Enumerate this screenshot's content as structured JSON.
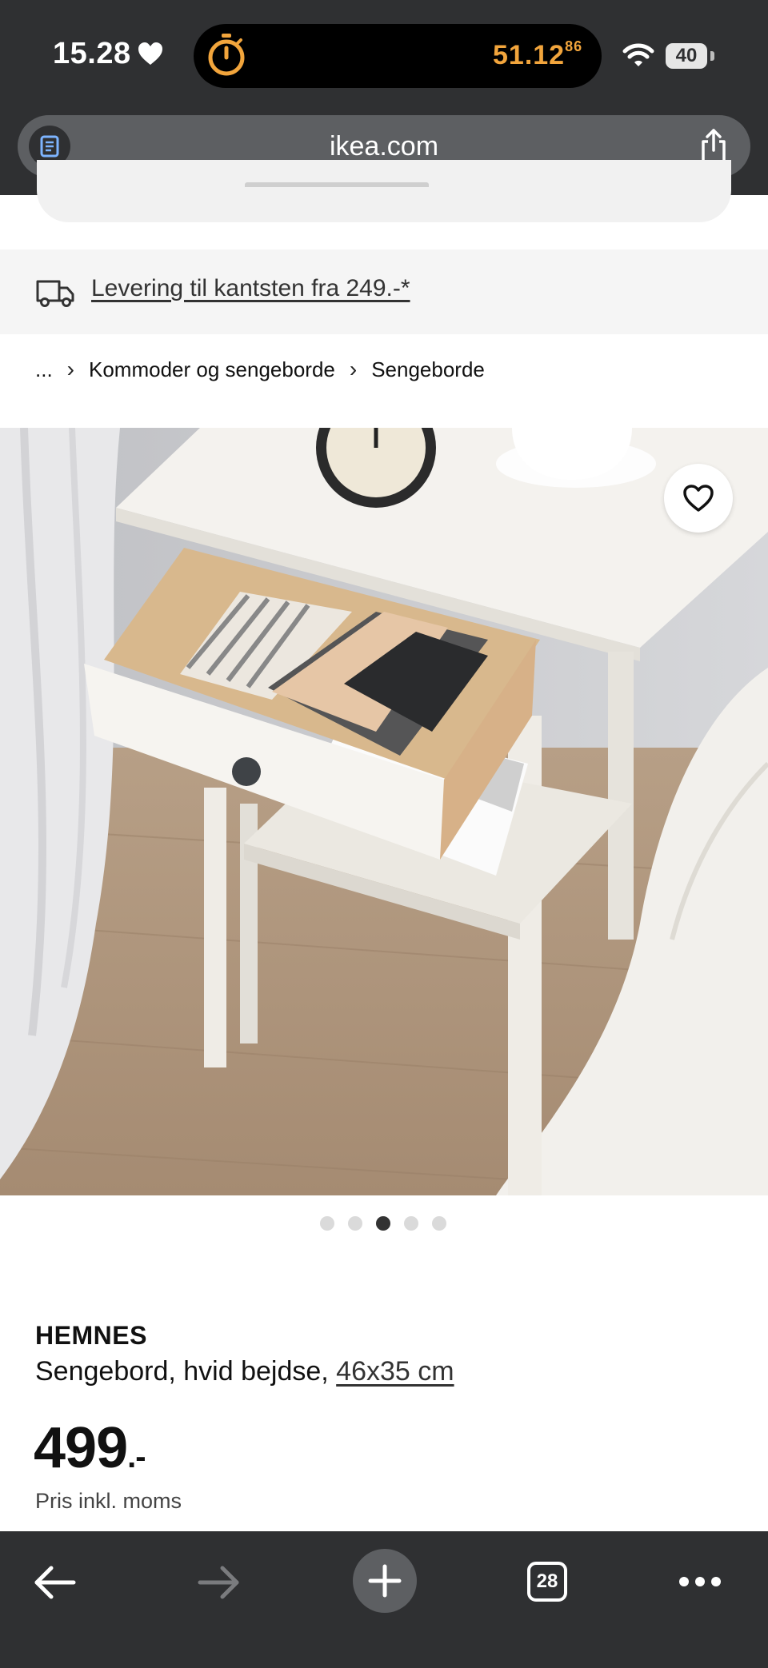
{
  "status_bar": {
    "time": "15.28",
    "timer_main": "51.12",
    "timer_fraction": "86",
    "battery": "40",
    "timer_color": "#f2a53c"
  },
  "browser": {
    "url": "ikea.com"
  },
  "delivery_banner": {
    "text": "Levering til kantsten fra 249.-*"
  },
  "breadcrumb": {
    "ellipsis": "...",
    "items": [
      "Kommoder og sengeborde",
      "Sengeborde"
    ]
  },
  "gallery": {
    "image_count": 5,
    "active_index": 2
  },
  "product": {
    "name": "HEMNES",
    "description": "Sengebord, hvid bejdse,",
    "size": "46x35 cm",
    "price": "499",
    "price_suffix": ".-",
    "vat_note": "Pris inkl. moms"
  },
  "toolbar": {
    "tab_count": "28"
  },
  "colors": {
    "chrome": "#2f3032",
    "urlbar": "#5d5f62",
    "banner_bg": "#f5f5f5"
  }
}
